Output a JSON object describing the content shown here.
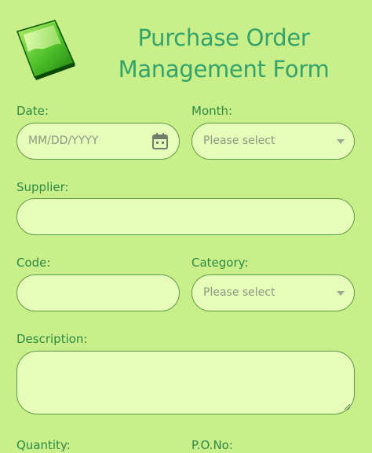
{
  "form": {
    "title_line1": "Purchase Order",
    "title_line2": "Management Form"
  },
  "fields": {
    "date": {
      "label": "Date:",
      "placeholder": "MM/DD/YYYY"
    },
    "month": {
      "label": "Month:",
      "value": "Please select"
    },
    "supplier": {
      "label": "Supplier:",
      "value": ""
    },
    "code": {
      "label": "Code:",
      "value": ""
    },
    "category": {
      "label": "Category:",
      "value": "Please select"
    },
    "description": {
      "label": "Description:",
      "value": ""
    },
    "quantity": {
      "label": "Quantity:"
    },
    "po_no": {
      "label": "P.O.No:"
    }
  },
  "icons": {
    "logo": "document-icon",
    "date": "calendar-icon",
    "select": "chevron-down-icon",
    "resize": "resize-handle-icon"
  },
  "colors": {
    "background": "#c8ef8a",
    "title": "#33a36b",
    "label": "#2e8a45",
    "field_fill": "#e6fcb8",
    "field_border": "#5f9a4b"
  }
}
